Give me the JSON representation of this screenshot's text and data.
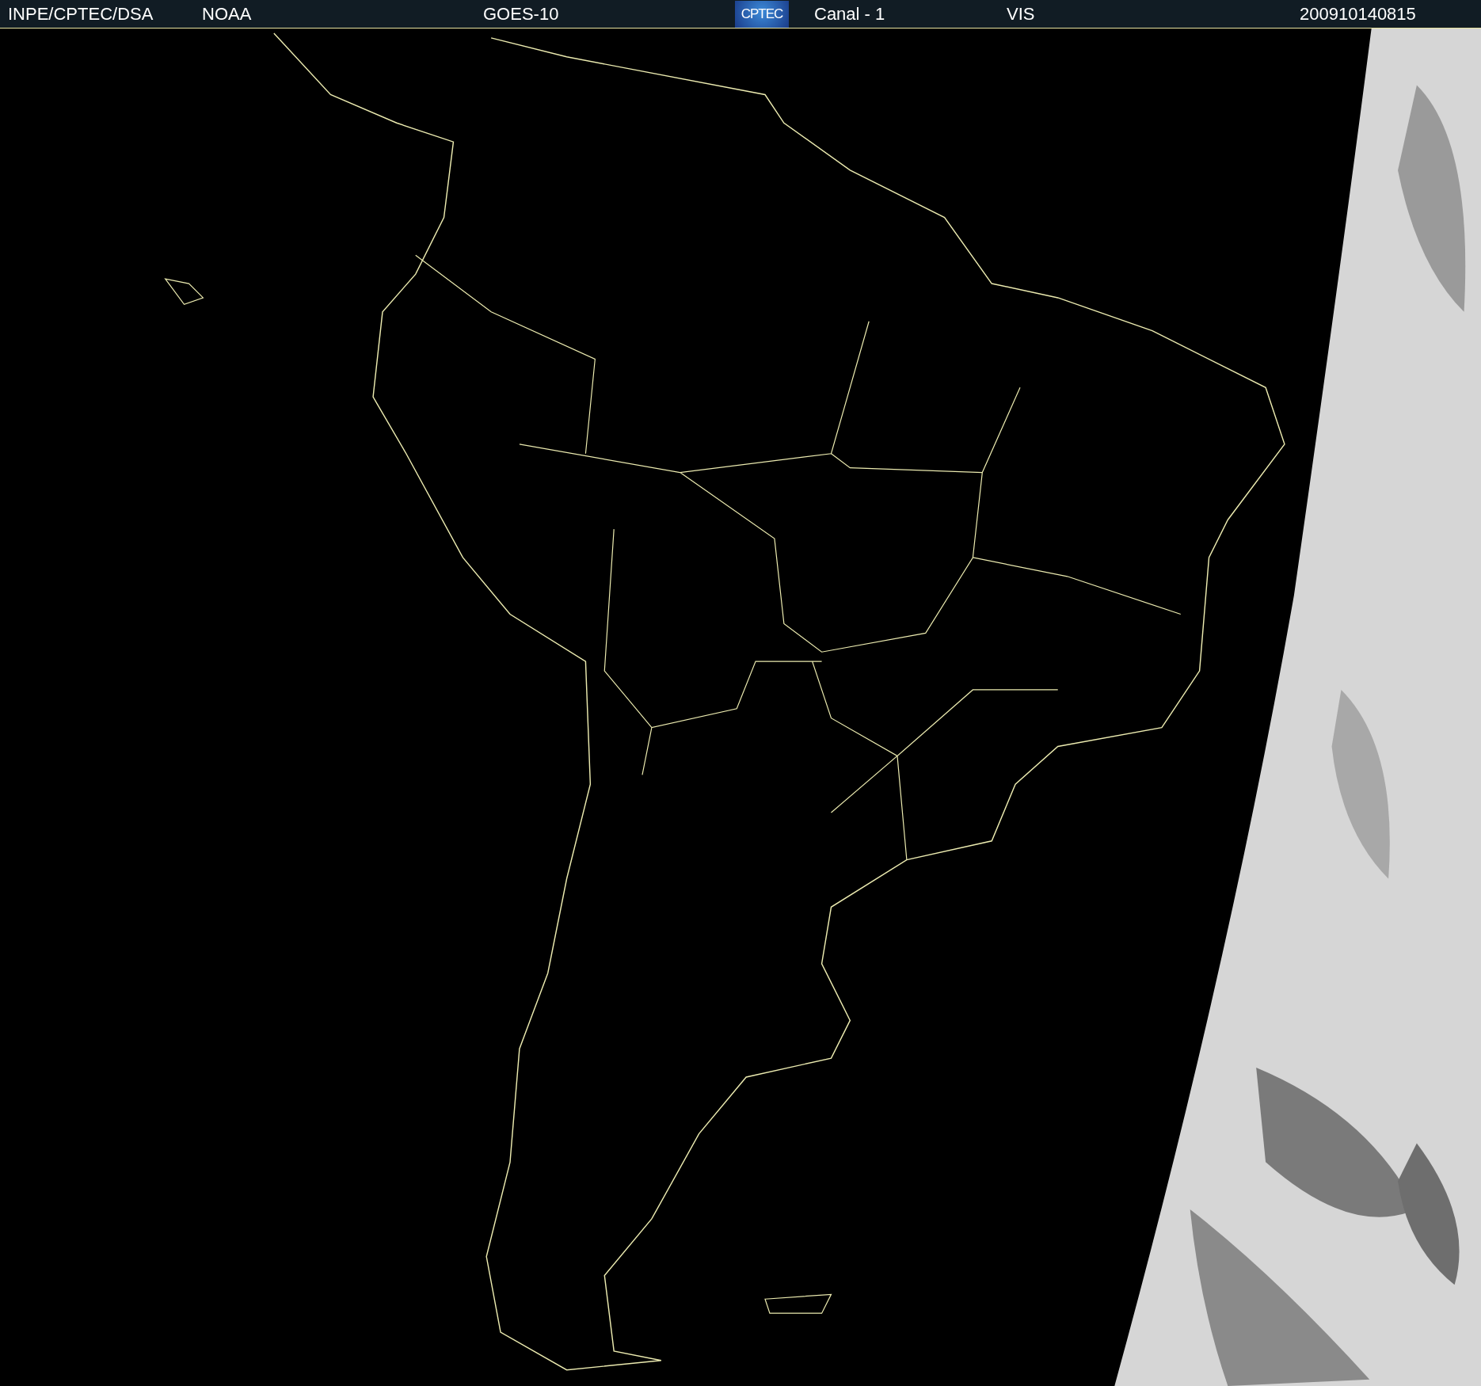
{
  "header": {
    "items": [
      {
        "kind": "text",
        "text": "INPE/CPTEC/DSA"
      },
      {
        "kind": "text",
        "text": "NOAA"
      },
      {
        "kind": "text",
        "text": "GOES-10"
      },
      {
        "kind": "logo",
        "text": "CPTEC"
      },
      {
        "kind": "text",
        "text": "Canal - 1"
      },
      {
        "kind": "text",
        "text": "VIS"
      },
      {
        "kind": "text",
        "text": "200910140815"
      }
    ]
  }
}
